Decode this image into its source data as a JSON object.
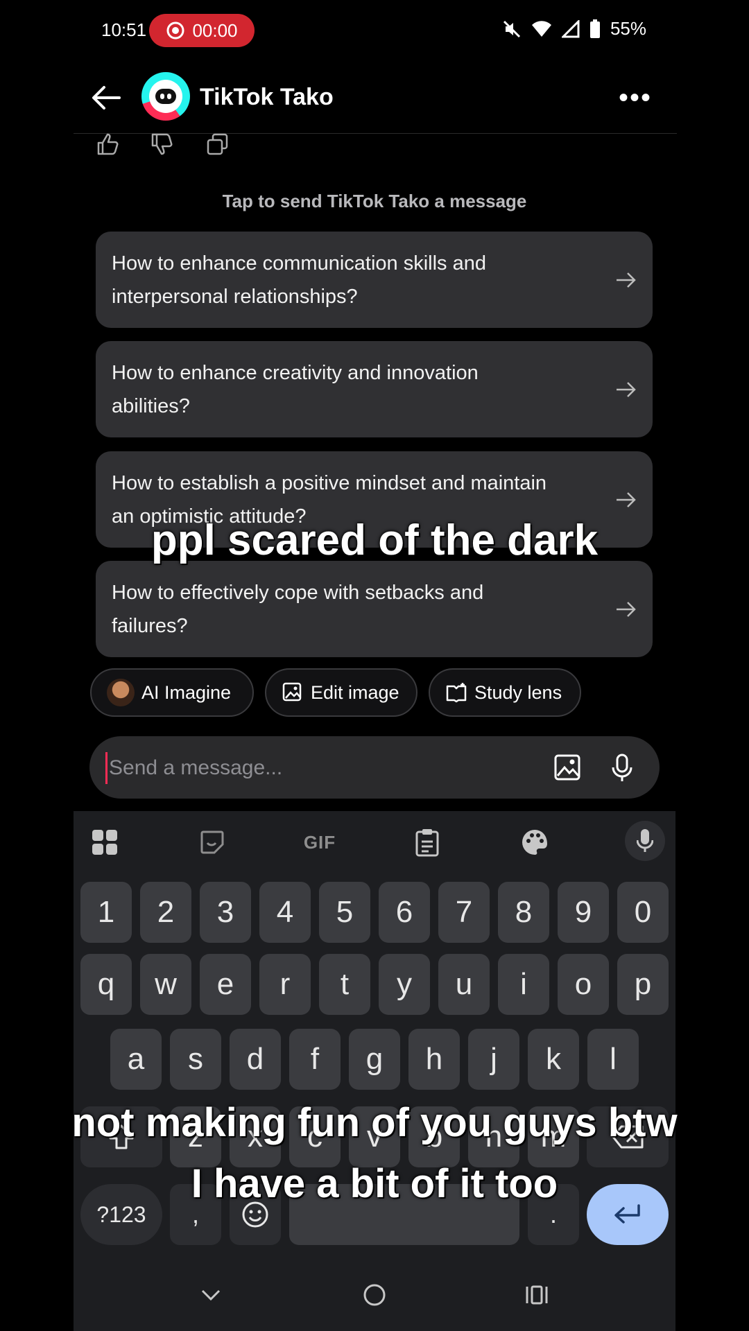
{
  "status_bar": {
    "time": "10:51",
    "recording": "00:00",
    "battery": "55%"
  },
  "header": {
    "title": "TikTok Tako"
  },
  "hint": "Tap to send TikTok Tako a message",
  "suggestions": [
    {
      "text": "How to enhance communication skills and interpersonal relationships?"
    },
    {
      "text": "How to enhance creativity and innovation abilities?"
    },
    {
      "text": "How to establish a positive mindset and maintain an optimistic attitude?"
    },
    {
      "text": "How to effectively cope with setbacks and failures?"
    }
  ],
  "chips": [
    {
      "label": "AI Imagine",
      "icon": "avatar-icon"
    },
    {
      "label": "Edit image",
      "icon": "edit-image-icon"
    },
    {
      "label": "Study lens",
      "icon": "study-lens-icon"
    }
  ],
  "composer": {
    "placeholder": "Send a message..."
  },
  "keyboard": {
    "toolbar": [
      "apps-icon",
      "sticker-icon",
      "GIF",
      "clipboard-icon",
      "palette-icon",
      "mic-icon"
    ],
    "row_numbers": [
      "1",
      "2",
      "3",
      "4",
      "5",
      "6",
      "7",
      "8",
      "9",
      "0"
    ],
    "row1": [
      "q",
      "w",
      "e",
      "r",
      "t",
      "y",
      "u",
      "i",
      "o",
      "p"
    ],
    "row2": [
      "a",
      "s",
      "d",
      "f",
      "g",
      "h",
      "j",
      "k",
      "l"
    ],
    "row3": [
      "z",
      "x",
      "c",
      "v",
      "b",
      "n",
      "m"
    ],
    "symbols_label": "?123",
    "comma": ",",
    "period": "."
  },
  "captions": {
    "top": "ppl scared of the dark",
    "bottom_line1": "not making fun of you guys btw",
    "bottom_line2": "I have a bit of it too"
  }
}
